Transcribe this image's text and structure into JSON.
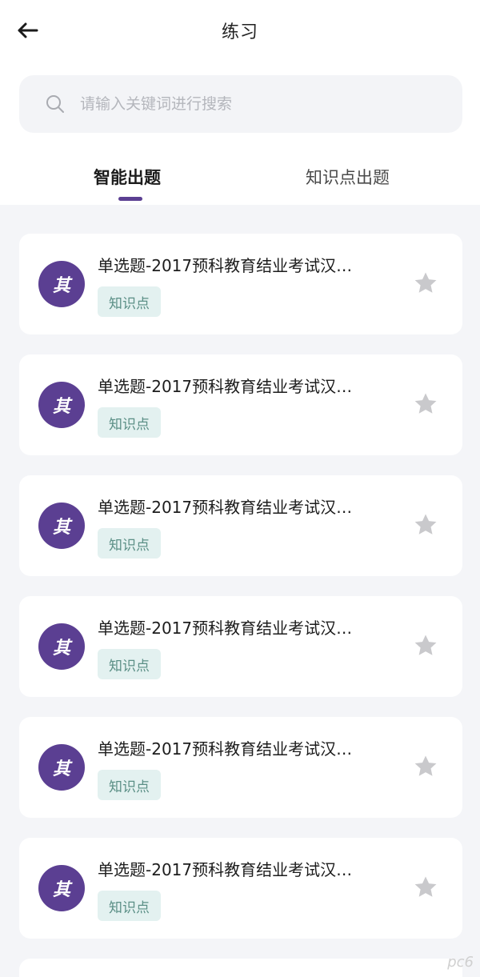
{
  "header": {
    "title": "练习"
  },
  "search": {
    "placeholder": "请输入关键词进行搜索"
  },
  "tabs": [
    {
      "label": "智能出题",
      "active": true
    },
    {
      "label": "知识点出题",
      "active": false
    }
  ],
  "items": [
    {
      "avatar": "其",
      "title": "单选题-2017预科教育结业考试汉…",
      "tag": "知识点"
    },
    {
      "avatar": "其",
      "title": "单选题-2017预科教育结业考试汉…",
      "tag": "知识点"
    },
    {
      "avatar": "其",
      "title": "单选题-2017预科教育结业考试汉…",
      "tag": "知识点"
    },
    {
      "avatar": "其",
      "title": "单选题-2017预科教育结业考试汉…",
      "tag": "知识点"
    },
    {
      "avatar": "其",
      "title": "单选题-2017预科教育结业考试汉…",
      "tag": "知识点"
    },
    {
      "avatar": "其",
      "title": "单选题-2017预科教育结业考试汉…",
      "tag": "知识点"
    }
  ],
  "watermark": "pc6",
  "colors": {
    "accent": "#5b3f92",
    "tag_bg": "#e3f1f0",
    "tag_text": "#5b8f86",
    "background": "#f4f5f8"
  }
}
